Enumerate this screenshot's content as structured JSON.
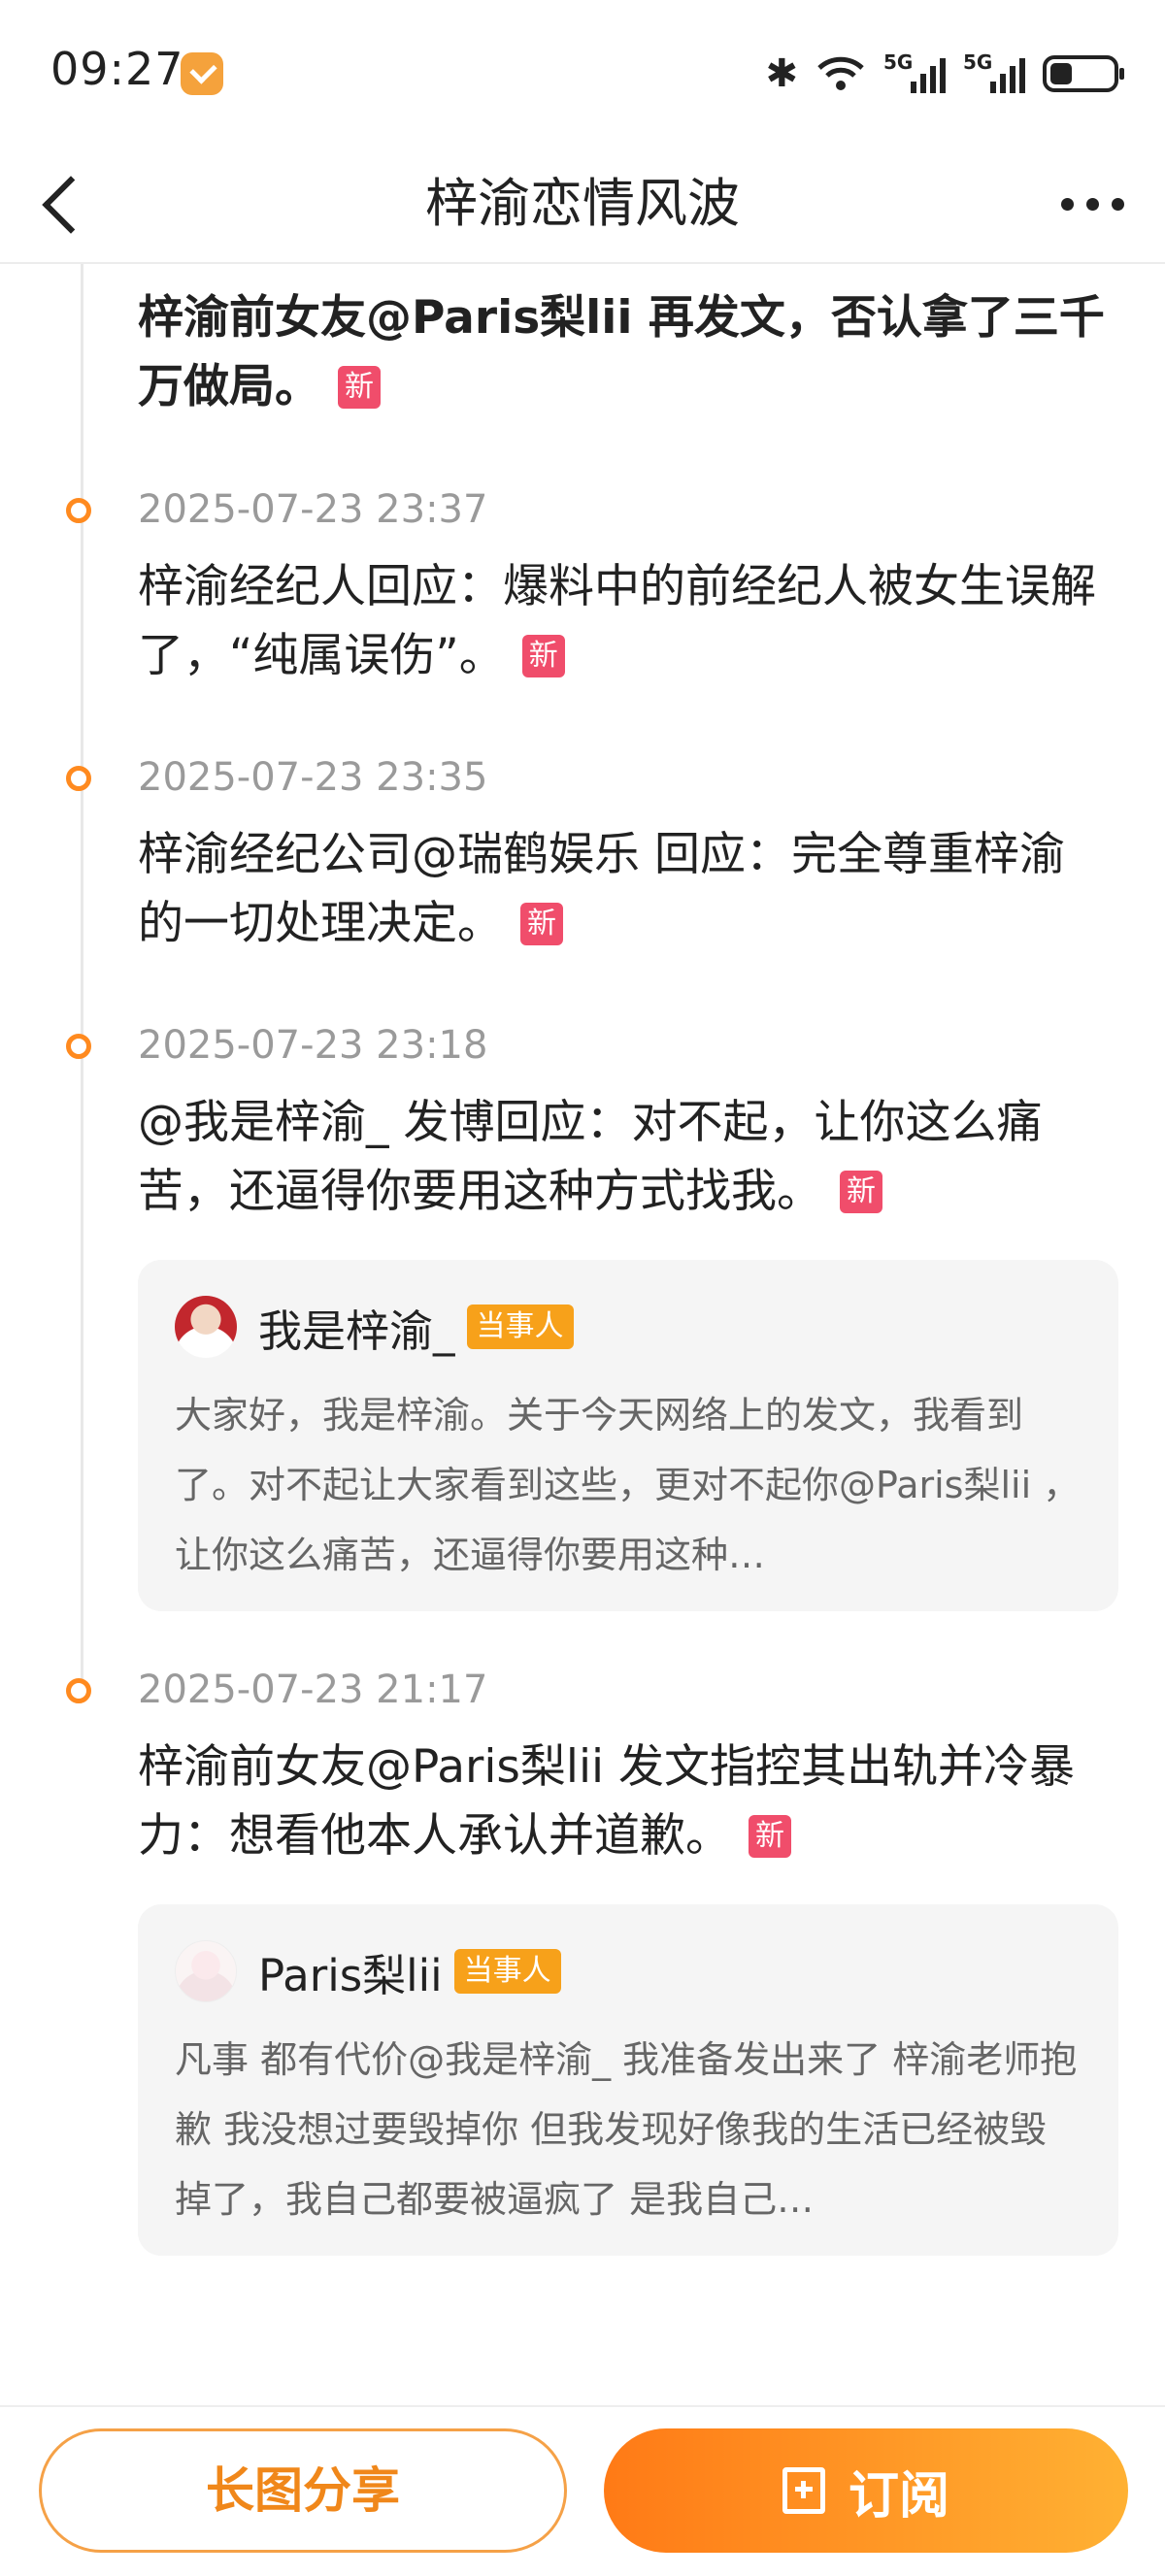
{
  "status_bar": {
    "time": "09:27",
    "network_1": "5G",
    "network_2": "5G"
  },
  "nav": {
    "title": "梓渝恋情风波"
  },
  "timeline": [
    {
      "headline": "梓渝前女友@Paris梨lii 再发文，否认拿了三千万做局。",
      "badge": "新"
    },
    {
      "date": "2025-07-23 23:37",
      "headline": "梓渝经纪人回应：爆料中的前经纪人被女生误解了，“纯属误伤”。",
      "badge": "新"
    },
    {
      "date": "2025-07-23 23:35",
      "headline": "梓渝经纪公司@瑞鹤娱乐 回应：完全尊重梓渝的一切处理决定。",
      "badge": "新"
    },
    {
      "date": "2025-07-23 23:18",
      "headline": "@我是梓渝_ 发博回应：对不起，让你这么痛苦，还逼得你要用这种方式找我。",
      "badge": "新",
      "quote": {
        "name": "我是梓渝_",
        "badge": "当事人",
        "text": "大家好，我是梓渝。关于今天网络上的发文，我看到了。对不起让大家看到这些，更对不起你@Paris梨lii ，让你这么痛苦，还逼得你要用这种…"
      }
    },
    {
      "date": "2025-07-23 21:17",
      "headline": "梓渝前女友@Paris梨lii 发文指控其出轨并冷暴力：想看他本人承认并道歉。",
      "badge": "新",
      "quote": {
        "name": "Paris梨lii",
        "badge": "当事人",
        "text": "凡事 都有代价@我是梓渝_ 我准备发出来了 梓渝老师抱歉 我没想过要毁掉你 但我发现好像我的生活已经被毁掉了，我自己都要被逼疯了 是我自己…"
      }
    }
  ],
  "bottom_bar": {
    "share_label": "长图分享",
    "subscribe_label": "订阅"
  },
  "colors": {
    "accent": "#ff8a1f",
    "new_badge": "#f04d6b",
    "party_badge": "#f7a11a"
  }
}
